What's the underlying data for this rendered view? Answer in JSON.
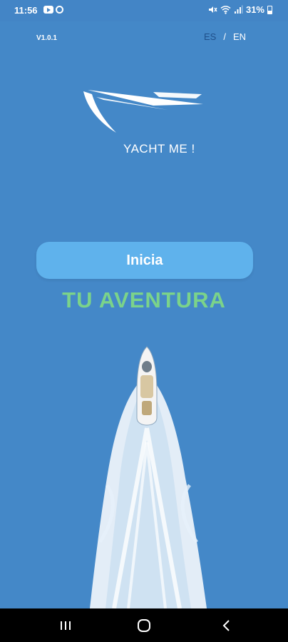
{
  "status_bar": {
    "time": "11:56",
    "battery": "31%"
  },
  "app": {
    "version": "V1.0.1",
    "languages": {
      "es": "ES",
      "separator": "/",
      "en": "EN"
    },
    "logo_text": "YACHT ME !",
    "start_button": "Inicia",
    "tagline": "TU AVENTURA"
  },
  "colors": {
    "background": "#4488c8",
    "button": "#5fb2ec",
    "tagline": "#7bd38a",
    "active_language": "#1f4f8a"
  },
  "icons": {
    "status": [
      "youtube-icon",
      "sync-icon",
      "mute-icon",
      "wifi-icon",
      "signal-icon",
      "battery-icon"
    ],
    "navigation": [
      "recent-apps-icon",
      "home-icon",
      "back-icon"
    ]
  }
}
